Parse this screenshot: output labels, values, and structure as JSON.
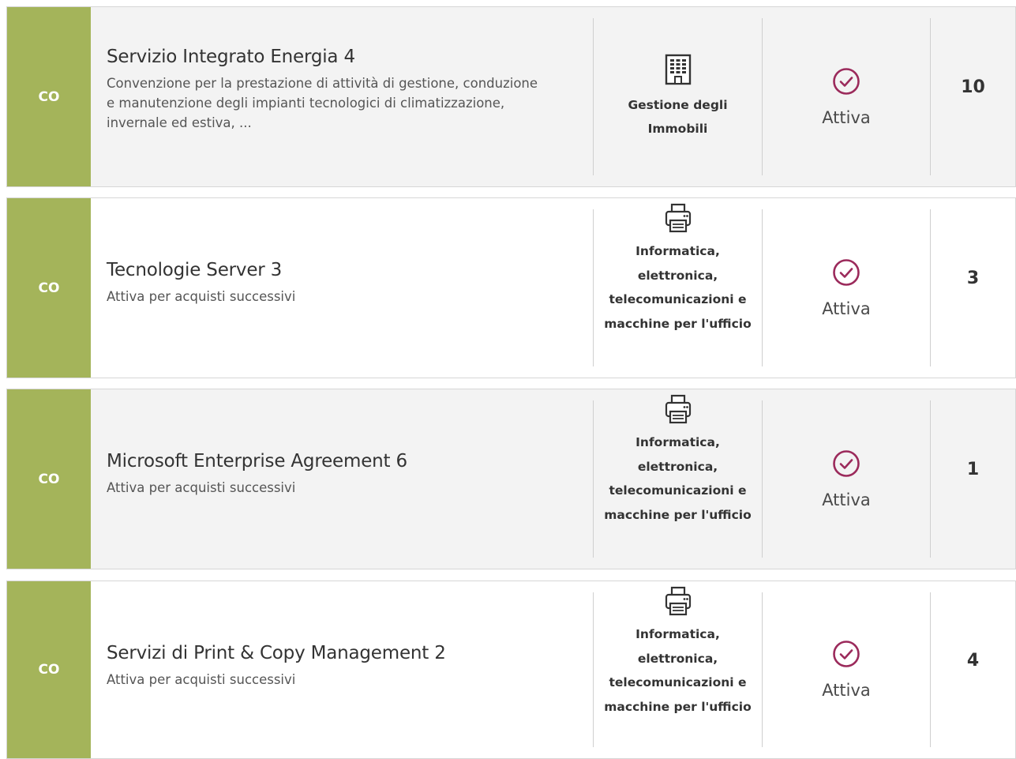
{
  "colors": {
    "tag_background": "#a4b45a",
    "check_icon": "#9b2a5b"
  },
  "rows": [
    {
      "tag": "CO",
      "title": "Servizio Integrato Energia 4",
      "description": "Convenzione per la prestazione di attività di gestione, conduzione e manutenzione degli impianti tecnologici di climatizzazione, invernale ed estiva, ...",
      "category": "Gestione degli Immobili",
      "category_icon": "building-icon",
      "status": "Attiva",
      "status_icon": "check-circle-icon",
      "count": "10"
    },
    {
      "tag": "CO",
      "title": "Tecnologie Server 3",
      "description": "Attiva per acquisti successivi",
      "category": "Informatica, elettronica, telecomunicazioni e macchine per l'ufficio",
      "category_icon": "printer-icon",
      "status": "Attiva",
      "status_icon": "check-circle-icon",
      "count": "3"
    },
    {
      "tag": "CO",
      "title": "Microsoft Enterprise Agreement 6",
      "description": "Attiva per acquisti successivi",
      "category": "Informatica, elettronica, telecomunicazioni e macchine per l'ufficio",
      "category_icon": "printer-icon",
      "status": "Attiva",
      "status_icon": "check-circle-icon",
      "count": "1"
    },
    {
      "tag": "CO",
      "title": "Servizi di Print & Copy Management 2",
      "description": "Attiva per acquisti successivi",
      "category": "Informatica, elettronica, telecomunicazioni e macchine per l'ufficio",
      "category_icon": "printer-icon",
      "status": "Attiva",
      "status_icon": "check-circle-icon",
      "count": "4"
    }
  ]
}
